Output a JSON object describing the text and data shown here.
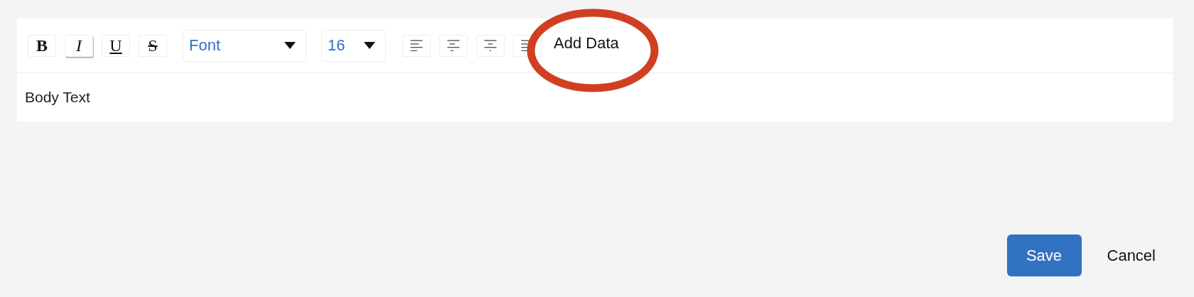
{
  "toolbar": {
    "format_buttons": [
      {
        "kind": "bold",
        "label": "B",
        "selected": false
      },
      {
        "kind": "italic",
        "label": "I",
        "selected": true
      },
      {
        "kind": "underline",
        "label": "U",
        "selected": false
      },
      {
        "kind": "strikethrough",
        "label": "S",
        "selected": false
      }
    ],
    "font_dropdown": {
      "value": "Font"
    },
    "size_dropdown": {
      "value": "16"
    },
    "align_buttons": [
      {
        "kind": "left"
      },
      {
        "kind": "center"
      },
      {
        "kind": "right"
      },
      {
        "kind": "justify"
      }
    ],
    "add_data": {
      "label": "Add Data",
      "highlighted": true
    }
  },
  "body": {
    "text": "Body Text"
  },
  "buttons": [
    {
      "kind": "primary",
      "label": "Save"
    },
    {
      "kind": "plain",
      "label": "Cancel"
    }
  ]
}
